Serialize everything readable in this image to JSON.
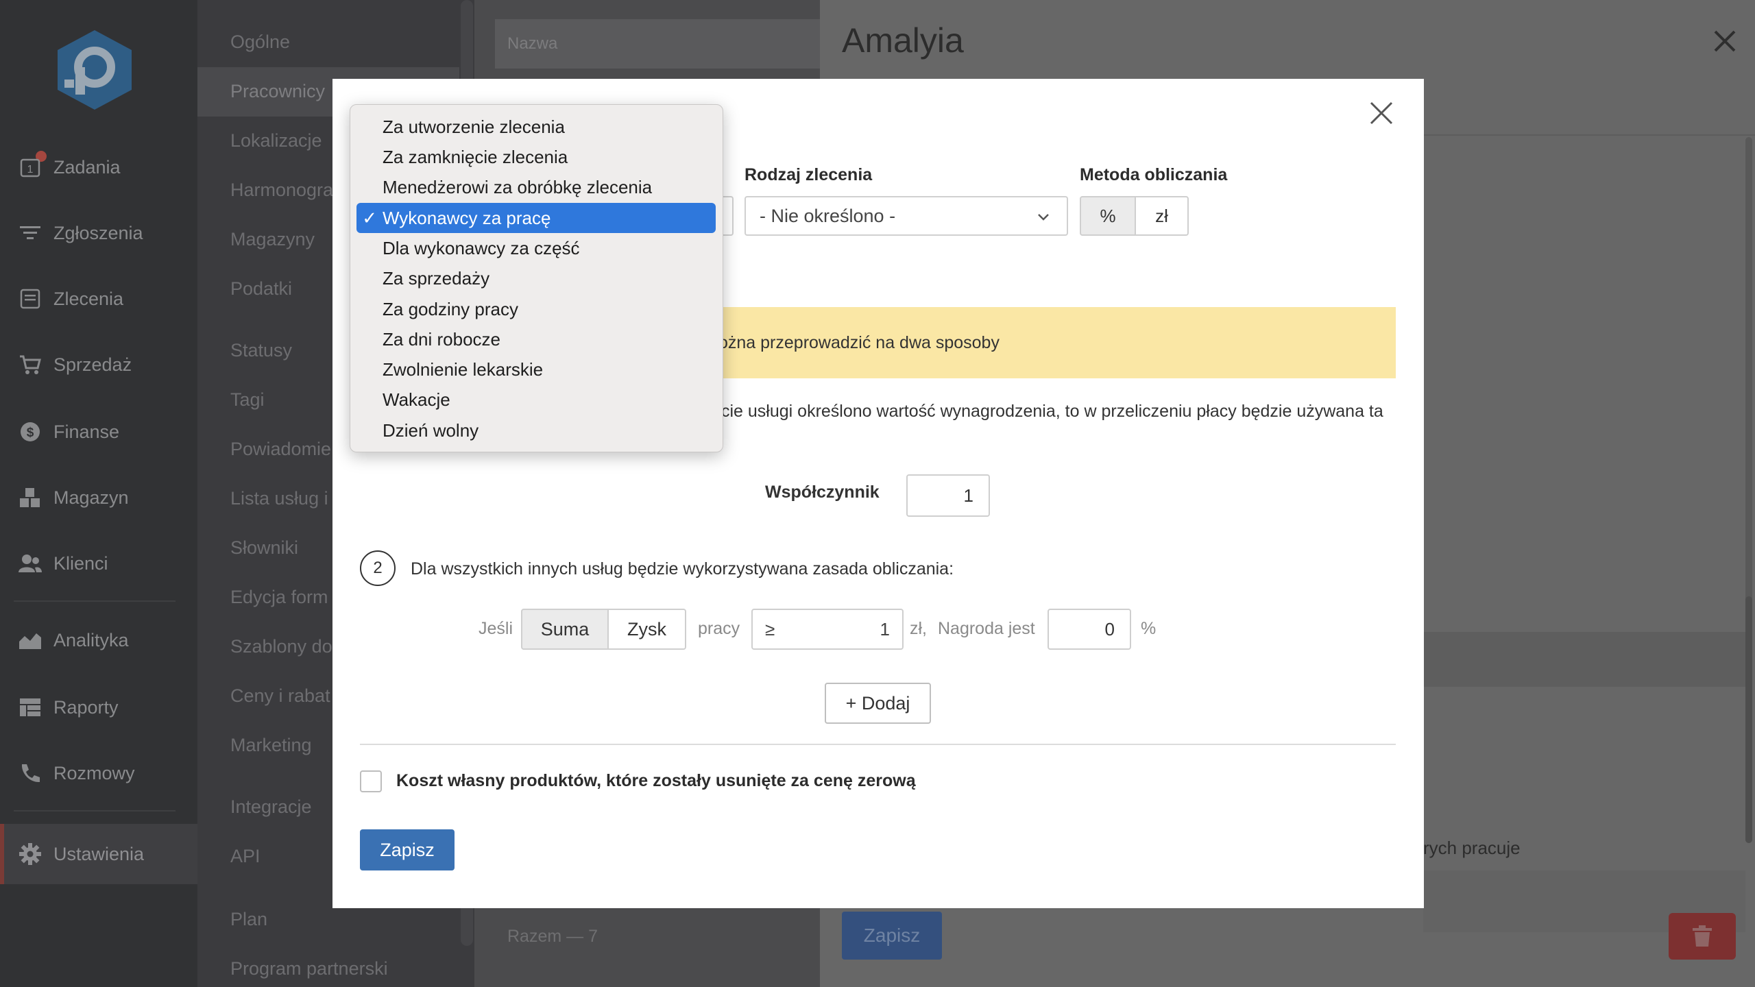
{
  "nav": {
    "badge_count": "1",
    "items": [
      {
        "label": "Zadania",
        "icon": "tasks-icon"
      },
      {
        "label": "Zgłoszenia",
        "icon": "filter-icon"
      },
      {
        "label": "Zlecenia",
        "icon": "orders-icon"
      },
      {
        "label": "Sprzedaż",
        "icon": "cart-icon"
      },
      {
        "label": "Finanse",
        "icon": "dollar-icon"
      },
      {
        "label": "Magazyn",
        "icon": "boxes-icon"
      },
      {
        "label": "Klienci",
        "icon": "users-icon"
      },
      {
        "label": "Analityka",
        "icon": "chart-icon"
      },
      {
        "label": "Raporty",
        "icon": "table-icon"
      },
      {
        "label": "Rozmowy",
        "icon": "phone-icon"
      },
      {
        "label": "Ustawienia",
        "icon": "gear-icon"
      }
    ]
  },
  "submenu": {
    "items": [
      "Ogólne",
      "Pracownicy",
      "Lokalizacje",
      "Harmonogra",
      "Magazyny",
      "Podatki",
      "Statusy",
      "Tagi",
      "Powiadomie",
      "Lista usług i",
      "Słowniki",
      "Edycja form",
      "Szablony do",
      "Ceny i rabat",
      "Marketing",
      "Integracje",
      "API",
      "Plan",
      "Program partnerski"
    ]
  },
  "list": {
    "name_header": "Nazwa",
    "total": "Razem — 7"
  },
  "detail": {
    "title": "Amalyia",
    "partial_text": "rych pracuje",
    "save_label": "Zapisz"
  },
  "modal": {
    "order_type_label": "Rodzaj zlecenia",
    "order_type_value": "- Nie określono -",
    "method_label": "Metoda obliczania",
    "method_options": [
      "%",
      "zł"
    ],
    "alert_text": "ożna przeprowadzić na dwa sposoby",
    "info_text": "cie usługi określono wartość wynagrodzenia, to w przeliczeniu płacy będzie używana ta",
    "coef_label": "Współczynnik",
    "coef_value": "1",
    "step_number": "2",
    "step_text": "Dla wszystkich innych usług będzie wykorzystywana zasada obliczania:",
    "if_label": "Jeśli",
    "basis_options": [
      "Suma",
      "Zysk"
    ],
    "work_label": "pracy",
    "gte_symbol": "≥",
    "threshold_value": "1",
    "currency": "zł,",
    "reward_label": "Nagroda jest",
    "reward_value": "0",
    "percent": "%",
    "add_label": "+ Dodaj",
    "checkbox_label": "Koszt własny produktów, które zostały usunięte za cenę zerową",
    "save_label": "Zapisz"
  },
  "dropdown": {
    "selected_index": 3,
    "check_mark": "✓",
    "options": [
      "Za utworzenie zlecenia",
      "Za zamknięcie zlecenia",
      "Menedżerowi za obróbkę zlecenia",
      "Wykonawcy za pracę",
      "Dla wykonawcy za część",
      "Za sprzedaży",
      "Za godziny pracy",
      "Za dni robocze",
      "Zwolnienie lekarskie",
      "Wakacje",
      "Dzień wolny"
    ]
  },
  "colors": {
    "accent": "#3a71b3",
    "selected": "#2f78dc",
    "alert_bg": "#fae7a5",
    "danger": "#7d3030"
  }
}
